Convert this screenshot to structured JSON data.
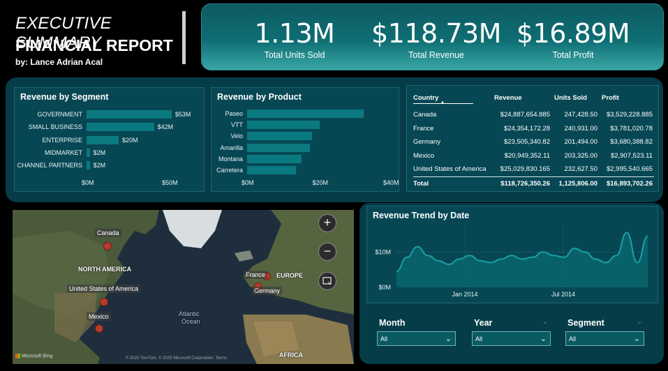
{
  "header": {
    "title": "EXECUTIVE SUMMARY",
    "subtitle": "FINANCIAL REPORT",
    "author": "by: Lance Adrian Acal"
  },
  "kpis": [
    {
      "value": "1.13M",
      "label": "Total Units Sold"
    },
    {
      "value": "$118.73M",
      "label": "Total Revenue"
    },
    {
      "value": "$16.89M",
      "label": "Total Profit"
    }
  ],
  "segment_chart": {
    "title": "Revenue by Segment",
    "categories": [
      "GOVERNMENT",
      "SMALL BUSINESS",
      "ENTERPRISE",
      "MIDMARKET",
      "CHANNEL PARTNERS"
    ],
    "values": [
      53,
      42,
      20,
      2,
      2
    ],
    "value_labels": [
      "$53M",
      "$42M",
      "$20M",
      "$2M",
      "$2M"
    ],
    "xticks": [
      "$0M",
      "$50M"
    ],
    "xmax": 50
  },
  "product_chart": {
    "title": "Revenue by Product",
    "categories": [
      "Paseo",
      "VTT",
      "Velo",
      "Amarilla",
      "Montana",
      "Carretera"
    ],
    "values": [
      33.0,
      20.5,
      18.3,
      17.7,
      15.4,
      13.8
    ],
    "xticks": [
      "$0M",
      "$20M",
      "$40M"
    ],
    "xmax": 40
  },
  "table": {
    "headers": [
      "Country",
      "Revenue",
      "Units Sold",
      "Profit"
    ],
    "rows": [
      [
        "Canada",
        "$24,887,654.885",
        "247,428.50",
        "$3,529,228.885"
      ],
      [
        "France",
        "$24,354,172.28",
        "240,931.00",
        "$3,781,020.78"
      ],
      [
        "Germany",
        "$23,505,340.82",
        "201,494.00",
        "$3,680,388.82"
      ],
      [
        "Mexico",
        "$20,949,352.11",
        "203,325.00",
        "$2,907,523.11"
      ],
      [
        "United States of America",
        "$25,029,830.165",
        "232,627.50",
        "$2,995,540.665"
      ]
    ],
    "total": [
      "Total",
      "$118,726,350.26",
      "1,125,806.00",
      "$16,893,702.26"
    ]
  },
  "map": {
    "labels": [
      "Canada",
      "United States of America",
      "Mexico",
      "France",
      "Germany"
    ],
    "regions": [
      "NORTH AMERICA",
      "EUROPE",
      "Atlantic",
      "Ocean",
      "AFRICA"
    ],
    "brand": "Microsoft Bing",
    "copyright": "© 2025 TomTom, © 2025 Microsoft Corporation, Terms",
    "zoom_in": "+",
    "zoom_out": "−",
    "colors": {
      "pin": "#b83a2c"
    }
  },
  "trend_chart": {
    "title": "Revenue Trend by Date",
    "type": "area",
    "yticks": [
      "$10M",
      "$0M"
    ],
    "xticks": [
      "Jan 2014",
      "Jul 2014"
    ],
    "values": [
      4.5,
      8.5,
      11.5,
      9,
      7.5,
      6.5,
      8,
      9,
      7.5,
      7,
      8,
      9,
      8,
      8.5,
      10,
      9,
      8.5,
      11,
      10,
      8,
      7,
      9,
      15.5,
      7,
      14.5
    ],
    "ylim": [
      0,
      15
    ]
  },
  "slicers": [
    {
      "label": "Month",
      "value": "All"
    },
    {
      "label": "Year",
      "value": "All"
    },
    {
      "label": "Segment",
      "value": "All"
    }
  ],
  "colors": {
    "accent": "#0b7a80",
    "panel": "#063c48",
    "card": "#074754"
  }
}
